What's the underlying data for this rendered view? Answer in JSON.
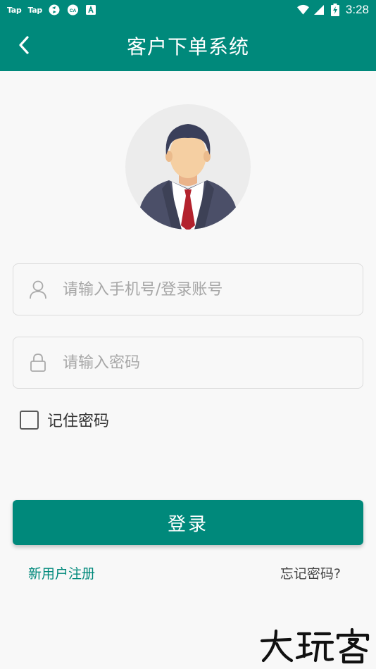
{
  "status_bar": {
    "left_labels": [
      "Tap",
      "Tap"
    ],
    "icons": [
      "refresh-app-icon",
      "cloud-app-icon",
      "font-app-icon"
    ],
    "time": "3:28",
    "battery_icon": "battery-charging-icon"
  },
  "appbar": {
    "title": "客户下单系统",
    "back_icon": "back-arrow-icon",
    "color": "#00897b"
  },
  "avatar": {
    "icon": "user-avatar-icon"
  },
  "form": {
    "account_placeholder": "请输入手机号/登录账号",
    "account_value": "",
    "password_placeholder": "请输入密码",
    "password_value": "",
    "remember_label": "记住密码",
    "remember_checked": false
  },
  "actions": {
    "login_label": "登录",
    "register_label": "新用户注册",
    "forgot_label": "忘记密码?"
  },
  "watermark": "大玩客",
  "colors": {
    "accent": "#00897b",
    "background": "#f8f8f8"
  }
}
